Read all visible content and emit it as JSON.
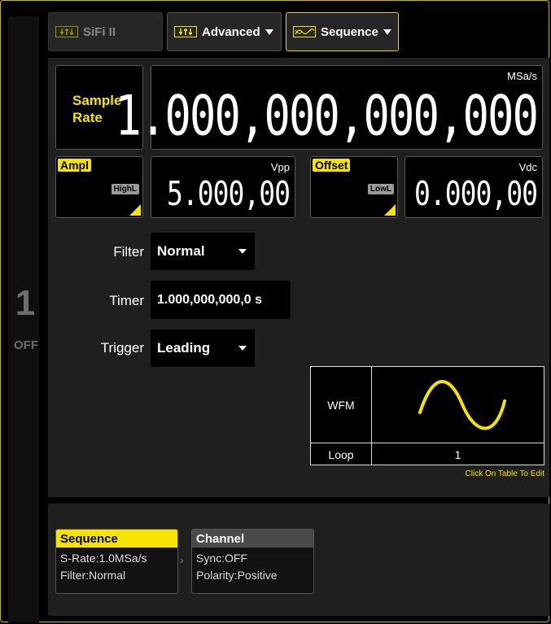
{
  "tabs": {
    "sifi": "SiFi II",
    "advanced": "Advanced",
    "sequence": "Sequence"
  },
  "channel": {
    "number": "1",
    "state": "OFF"
  },
  "sample_rate": {
    "label_line1": "Sample",
    "label_line2": "Rate",
    "value": "1.000,000,000,000",
    "unit": "MSa/s"
  },
  "ampl": {
    "tag": "Ampl",
    "alt_tag": "HighL",
    "value": "5.000,00",
    "unit": "Vpp"
  },
  "offset": {
    "tag": "Offset",
    "alt_tag": "LowL",
    "value": "0.000,00",
    "unit": "Vdc"
  },
  "filter": {
    "label": "Filter",
    "value": "Normal"
  },
  "timer": {
    "label": "Timer",
    "value": "1.000,000,000,0 s"
  },
  "trigger": {
    "label": "Trigger",
    "value": "Leading"
  },
  "seq_table": {
    "wfm_label": "WFM",
    "loop_label": "Loop",
    "loop_value": "1",
    "hint": "Click On Table To Edit"
  },
  "cards": {
    "sequence": {
      "title": "Sequence",
      "line1": "S-Rate:1.0MSa/s",
      "line2": "Filter:Normal"
    },
    "channel": {
      "title": "Channel",
      "line1": "Sync:OFF",
      "line2": "Polarity:Positive"
    }
  },
  "colors": {
    "accent": "#f5e300",
    "panel": "#1f1f1f",
    "border": "#c9b800"
  }
}
